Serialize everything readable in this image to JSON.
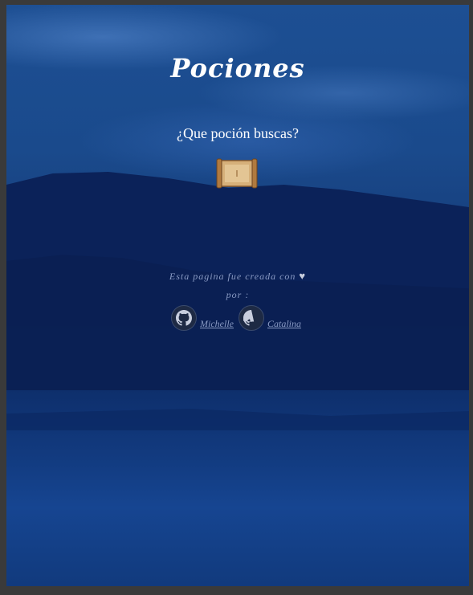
{
  "header": {
    "title": "Pociones",
    "subtitle": "¿Que poción buscas?"
  },
  "search": {
    "icon": "scroll-icon"
  },
  "footer": {
    "credit_text": "Esta pagina fue creada con",
    "heart_icon": "heart-icon",
    "by_text": "por :",
    "authors": [
      {
        "name": "Michelle",
        "icon": "github-icon"
      },
      {
        "name": "Catalina",
        "icon": "github-icon"
      }
    ]
  },
  "colors": {
    "text_primary": "#ffffff",
    "text_muted": "#8a9bc4",
    "background": "#173f7d"
  }
}
